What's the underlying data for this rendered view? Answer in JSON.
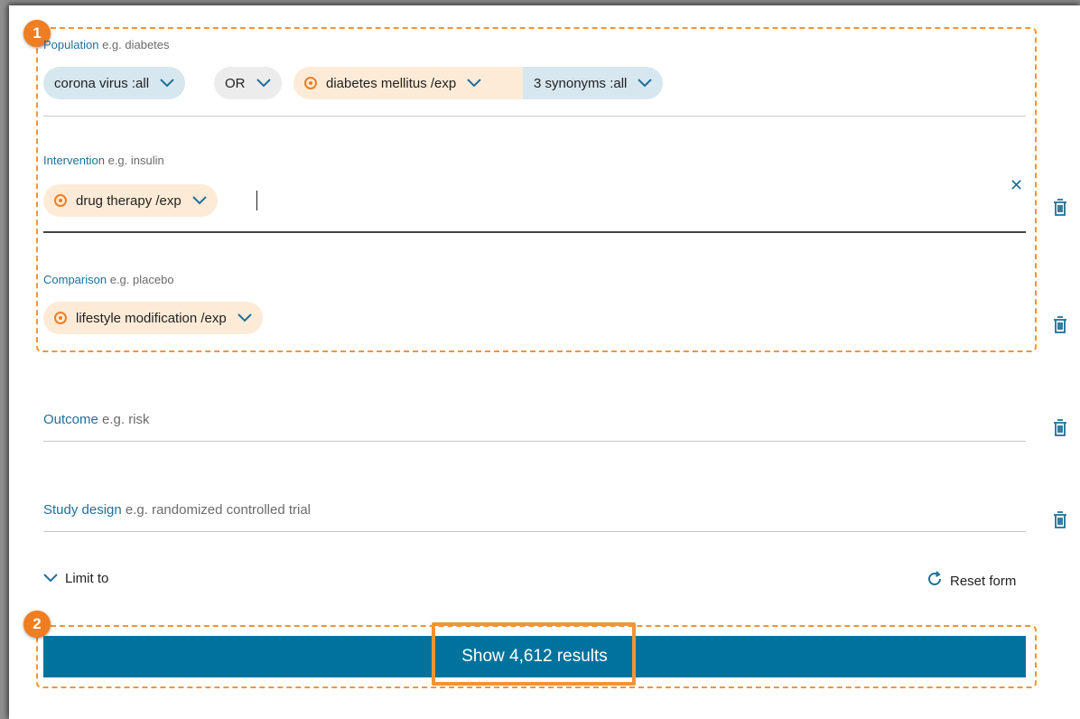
{
  "callouts": [
    "1",
    "2"
  ],
  "population": {
    "label": "Population",
    "hint": "e.g. diabetes",
    "chips": [
      {
        "text": "corona virus :all"
      },
      {
        "text": "OR"
      },
      {
        "text": "diabetes mellitus /exp"
      },
      {
        "text": "3 synonyms :all"
      }
    ]
  },
  "intervention": {
    "label": "Intervention",
    "hint": "e.g. insulin",
    "chips": [
      {
        "text": "drug therapy /exp"
      }
    ],
    "clear": "✕"
  },
  "comparison": {
    "label": "Comparison",
    "hint": "e.g. placebo",
    "chips": [
      {
        "text": "lifestyle modification /exp"
      }
    ]
  },
  "outcome": {
    "label": "Outcome",
    "hint": "e.g. risk"
  },
  "study_design": {
    "label": "Study design",
    "hint": "e.g. randomized controlled trial"
  },
  "limit_to": "Limit to",
  "reset_form": "Reset form",
  "show_results": "Show 4,612 results",
  "colors": {
    "accent_blue": "#00729c",
    "callout_orange": "#f39434",
    "chip_blue": "#d7e7ef",
    "chip_orange": "#fdebd8",
    "label_blue": "#1f6f98"
  },
  "icons": {
    "chevron": "chevron-down-icon",
    "target": "target-icon",
    "trash": "trash-icon",
    "reset": "refresh-icon",
    "clear": "close-icon"
  }
}
